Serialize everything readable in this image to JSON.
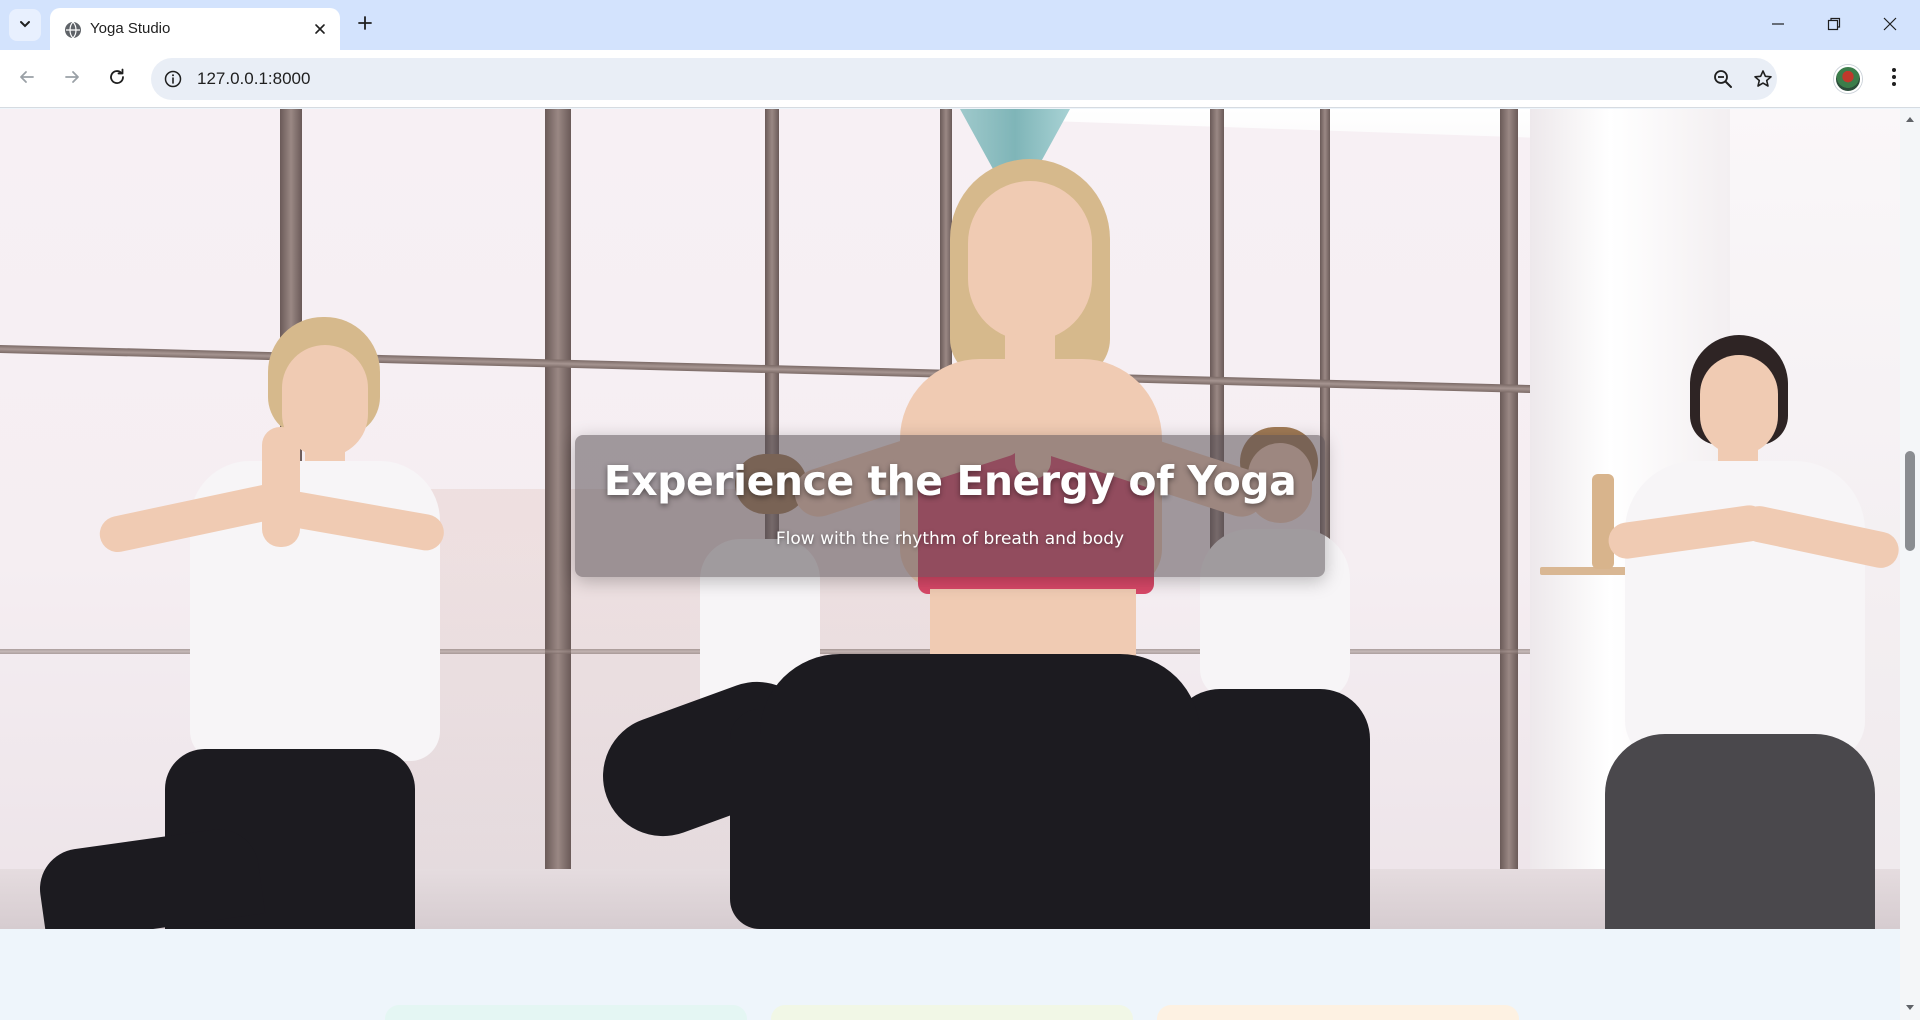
{
  "browser": {
    "tab_title": "Yoga Studio",
    "url": "127.0.0.1:8000",
    "icons": {
      "tab_search": "chevron-down-icon",
      "favicon": "globe-icon",
      "tab_close": "close-icon",
      "new_tab": "plus-icon",
      "back": "arrow-left-icon",
      "forward": "arrow-right-icon",
      "reload": "reload-icon",
      "site_info": "info-icon",
      "zoom": "zoom-out-icon",
      "bookmark": "star-icon",
      "profile": "avatar",
      "menu": "kebab-menu-icon",
      "minimize": "minimize-icon",
      "restore": "restore-icon",
      "close_window": "close-icon"
    }
  },
  "hero": {
    "title": "Experience the Energy of Yoga",
    "subtitle": "Flow with the rhythm of breath and body",
    "image_subject": "yoga class in bright studio, women in prayer-hands tree pose"
  },
  "cards_peek_colors": [
    "#e4f6f3",
    "#f1f7e6",
    "#fdf1e2"
  ],
  "colors": {
    "tabbar_bg": "#d3e3fd",
    "omnibox_bg": "#e9eef6",
    "page_bg": "#eef5fb",
    "overlay_bg": "rgba(90,80,85,0.55)"
  }
}
